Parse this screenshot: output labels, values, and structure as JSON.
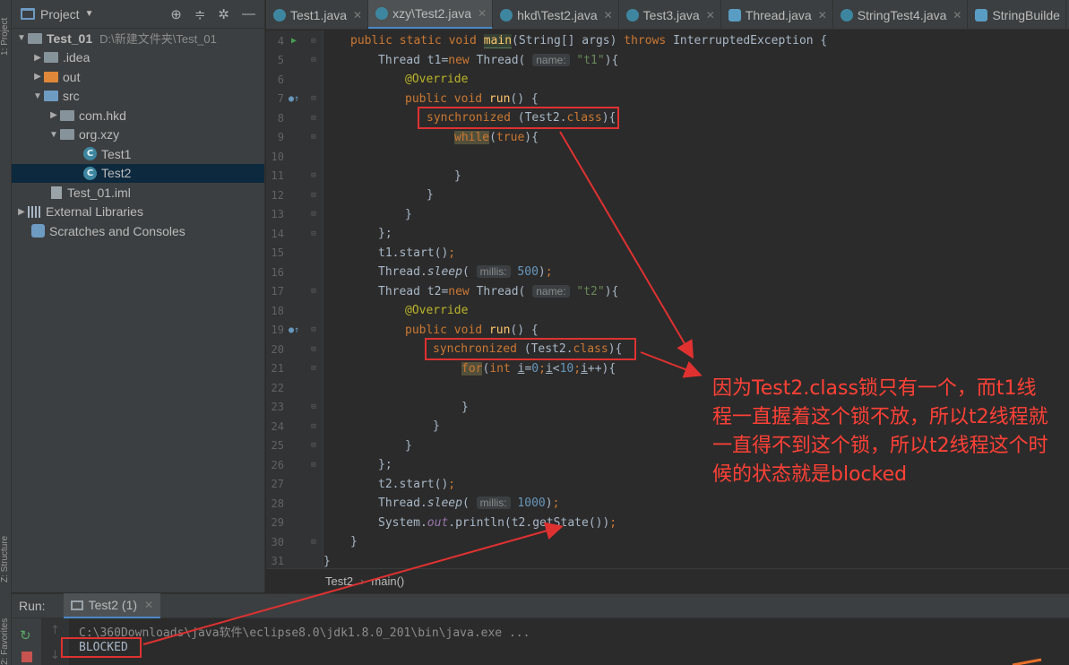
{
  "tool_strip": {
    "project_label": "1: Project",
    "structure_label": "Z: Structure",
    "favorites_label": "2: Favorites"
  },
  "project_panel": {
    "title": "Project",
    "tree": [
      {
        "label": "Test_01",
        "hint": "D:\\新建文件夹\\Test_01",
        "icon": "module-folder-icon"
      },
      {
        "label": ".idea",
        "icon": "folder-icon"
      },
      {
        "label": "out",
        "icon": "folder-orange-icon"
      },
      {
        "label": "src",
        "icon": "source-folder-icon"
      },
      {
        "label": "com.hkd",
        "icon": "package-icon"
      },
      {
        "label": "org.xzy",
        "icon": "package-icon"
      },
      {
        "label": "Test1",
        "icon": "class-icon"
      },
      {
        "label": "Test2",
        "icon": "class-icon",
        "selected": true
      },
      {
        "label": "Test_01.iml",
        "icon": "iml-file-icon"
      },
      {
        "label": "External Libraries",
        "icon": "library-icon"
      },
      {
        "label": "Scratches and Consoles",
        "icon": "scratches-icon"
      }
    ]
  },
  "tabs": [
    {
      "label": "Test1.java"
    },
    {
      "label": "xzy\\Test2.java",
      "active": true
    },
    {
      "label": "hkd\\Test2.java"
    },
    {
      "label": "Test3.java"
    },
    {
      "label": "Thread.java"
    },
    {
      "label": "StringTest4.java"
    },
    {
      "label": "StringBuilde"
    }
  ],
  "editor": {
    "line_numbers": [
      "4",
      "5",
      "6",
      "7",
      "8",
      "9",
      "10",
      "11",
      "12",
      "13",
      "14",
      "15",
      "16",
      "17",
      "18",
      "19",
      "20",
      "21",
      "22",
      "23",
      "24",
      "25",
      "26",
      "27",
      "28",
      "29",
      "30",
      "31"
    ],
    "hints": {
      "name": "name:",
      "millis": "millis:"
    }
  },
  "breadcrumb": {
    "class_name": "Test2",
    "method_name": "main()"
  },
  "run_panel": {
    "label": "Run:",
    "tab_label": "Test2 (1)",
    "command": "C:\\360Downloads\\java软件\\eclipse8.0\\jdk1.8.0_201\\bin\\java.exe ...",
    "output": "BLOCKED"
  },
  "annotation": {
    "text": "因为Test2.class锁只有一个，而t1线程一直握着这个锁不放，所以t2线程就一直得不到这个锁，所以t2线程这个时候的状态就是blocked",
    "color": "#ff4136"
  }
}
